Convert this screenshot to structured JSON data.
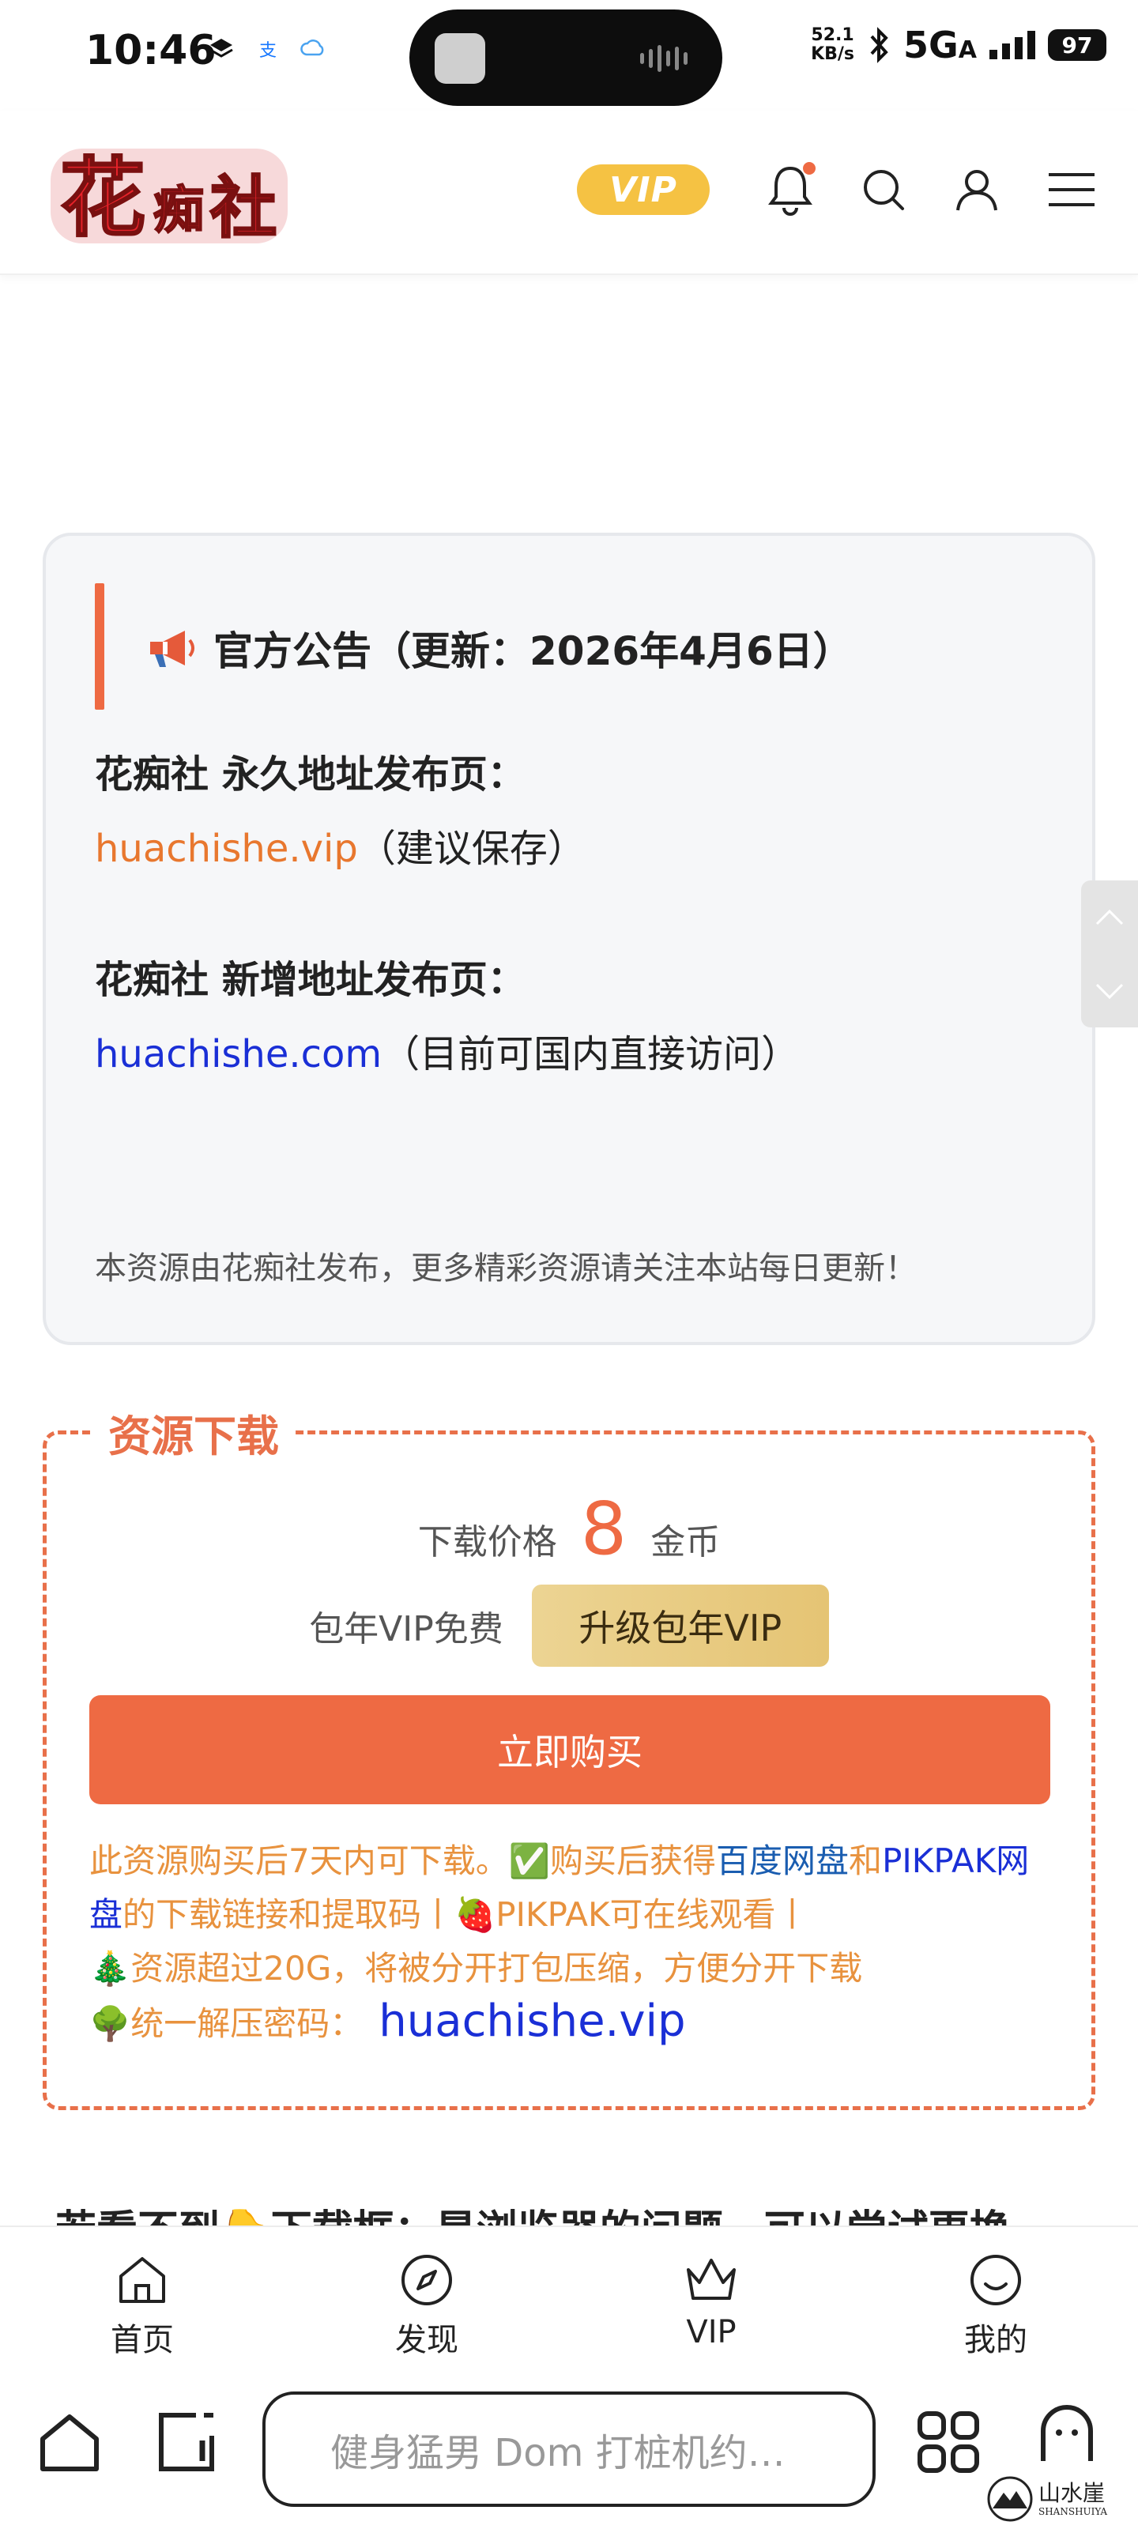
{
  "status_bar": {
    "time": "10:46",
    "speed_value": "52.1",
    "speed_unit": "KB/s",
    "network": "5G",
    "network_suffix": "A",
    "battery": "97"
  },
  "header": {
    "logo_text": "花痴社",
    "vip_label": "VIP",
    "brand_colors": {
      "logo_red": "#e8232a",
      "vip_gold": "#f5c243"
    }
  },
  "notice": {
    "title": "官方公告（更新：2026年4月6日）",
    "permanent_label": "花痴社 永久地址发布页：",
    "permanent_url": "huachishe.vip",
    "permanent_note": "（建议保存）",
    "new_label": "花痴社 新增地址发布页：",
    "new_url": "huachishe.com",
    "new_note": "（目前可国内直接访问）",
    "footer": "本资源由花痴社发布，更多精彩资源请关注本站每日更新！"
  },
  "download": {
    "title": "资源下载",
    "price_label": "下载价格",
    "price_value": "8",
    "price_unit": "金币",
    "vip_free": "包年VIP免费",
    "upgrade_button": "升级包年VIP",
    "buy_button": "立即购买",
    "note_part1": "此资源购买后7天内可下载。✅购买后获得",
    "note_baidu": "百度网盘",
    "note_and": "和",
    "note_pikpak": "PIKPAK网盘",
    "note_part2": "的下载链接和提取码丨🍓PIKPAK可在线观看丨",
    "note_part3": "🎄资源超过20G，将被分开打包压缩，方便分开下载",
    "password_label": "🌳统一解压密码：",
    "password_value": "huachishe.vip"
  },
  "cut_text": "若看不到👇下载框：是浏览器的问题，可以尝试更换",
  "bottom_nav": {
    "items": [
      {
        "label": "首页",
        "icon": "home-icon"
      },
      {
        "label": "发现",
        "icon": "compass-icon"
      },
      {
        "label": "VIP",
        "icon": "crown-icon"
      },
      {
        "label": "我的",
        "icon": "smile-icon"
      }
    ]
  },
  "browser_bar": {
    "search_text": "健身猛男 Dom 打桩机约…",
    "watermark_cn": "山水崖",
    "watermark_en": "SHANSHUIYA"
  }
}
